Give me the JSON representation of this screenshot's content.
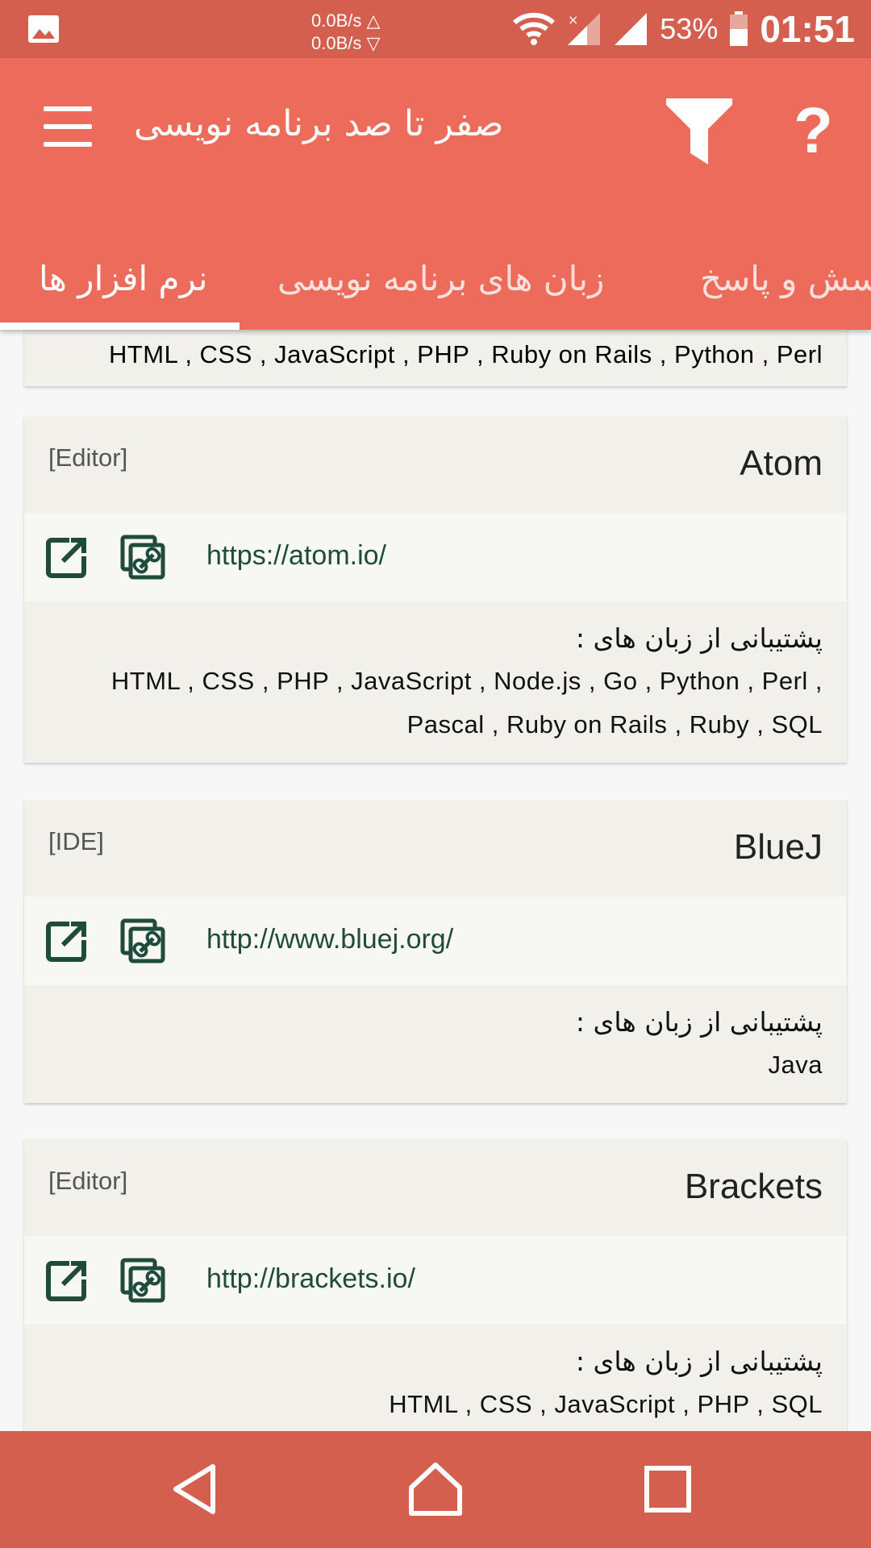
{
  "status_bar": {
    "net_up": "0.0B/s △",
    "net_down": "0.0B/s ▽",
    "battery": "53%",
    "time": "01:51",
    "icons": [
      "image-icon",
      "wifi-icon",
      "signal-1-icon",
      "signal-2-icon",
      "battery-icon"
    ]
  },
  "app_bar": {
    "title": "صفر تا صد برنامه نویسی",
    "menu_icon": "hamburger-icon",
    "filter_icon": "filter-icon",
    "help_label": "?"
  },
  "tabs": [
    {
      "label": "نرم افزار ها",
      "active": true
    },
    {
      "label": "زبان های برنامه نویسی",
      "active": false
    },
    {
      "label": "پرسش و پاسخ",
      "active": false
    }
  ],
  "top_partial": {
    "langs": "HTML , CSS , JavaScript , PHP , Ruby on Rails , Python , Perl"
  },
  "cards": [
    {
      "name": "Atom",
      "type": "[Editor]",
      "url": "https://atom.io/",
      "support_label": "پشتیبانی از زبان های :",
      "langs_line1": "HTML , CSS , PHP , JavaScript , Node.js , Go , Python , Perl ,",
      "langs_line2": "Pascal , Ruby on Rails , Ruby , SQL"
    },
    {
      "name": "BlueJ",
      "type": "[IDE]",
      "url": "http://www.bluej.org/",
      "support_label": "پشتیبانی از زبان های :",
      "langs_line1": "Java",
      "langs_line2": ""
    },
    {
      "name": "Brackets",
      "type": "[Editor]",
      "url": "http://brackets.io/",
      "support_label": "پشتیبانی از زبان های :",
      "langs_line1": "HTML , CSS , JavaScript , PHP , SQL",
      "langs_line2": ""
    }
  ],
  "nav_bar": {
    "icons": [
      "back-icon",
      "home-icon",
      "recents-icon"
    ]
  },
  "colors": {
    "status_bar": "#d45f4e",
    "app_bar": "#ec6b5a",
    "card_bg": "#f1f0eb",
    "url_text": "#1f4b3c",
    "icon_green": "#1f4b3c"
  }
}
